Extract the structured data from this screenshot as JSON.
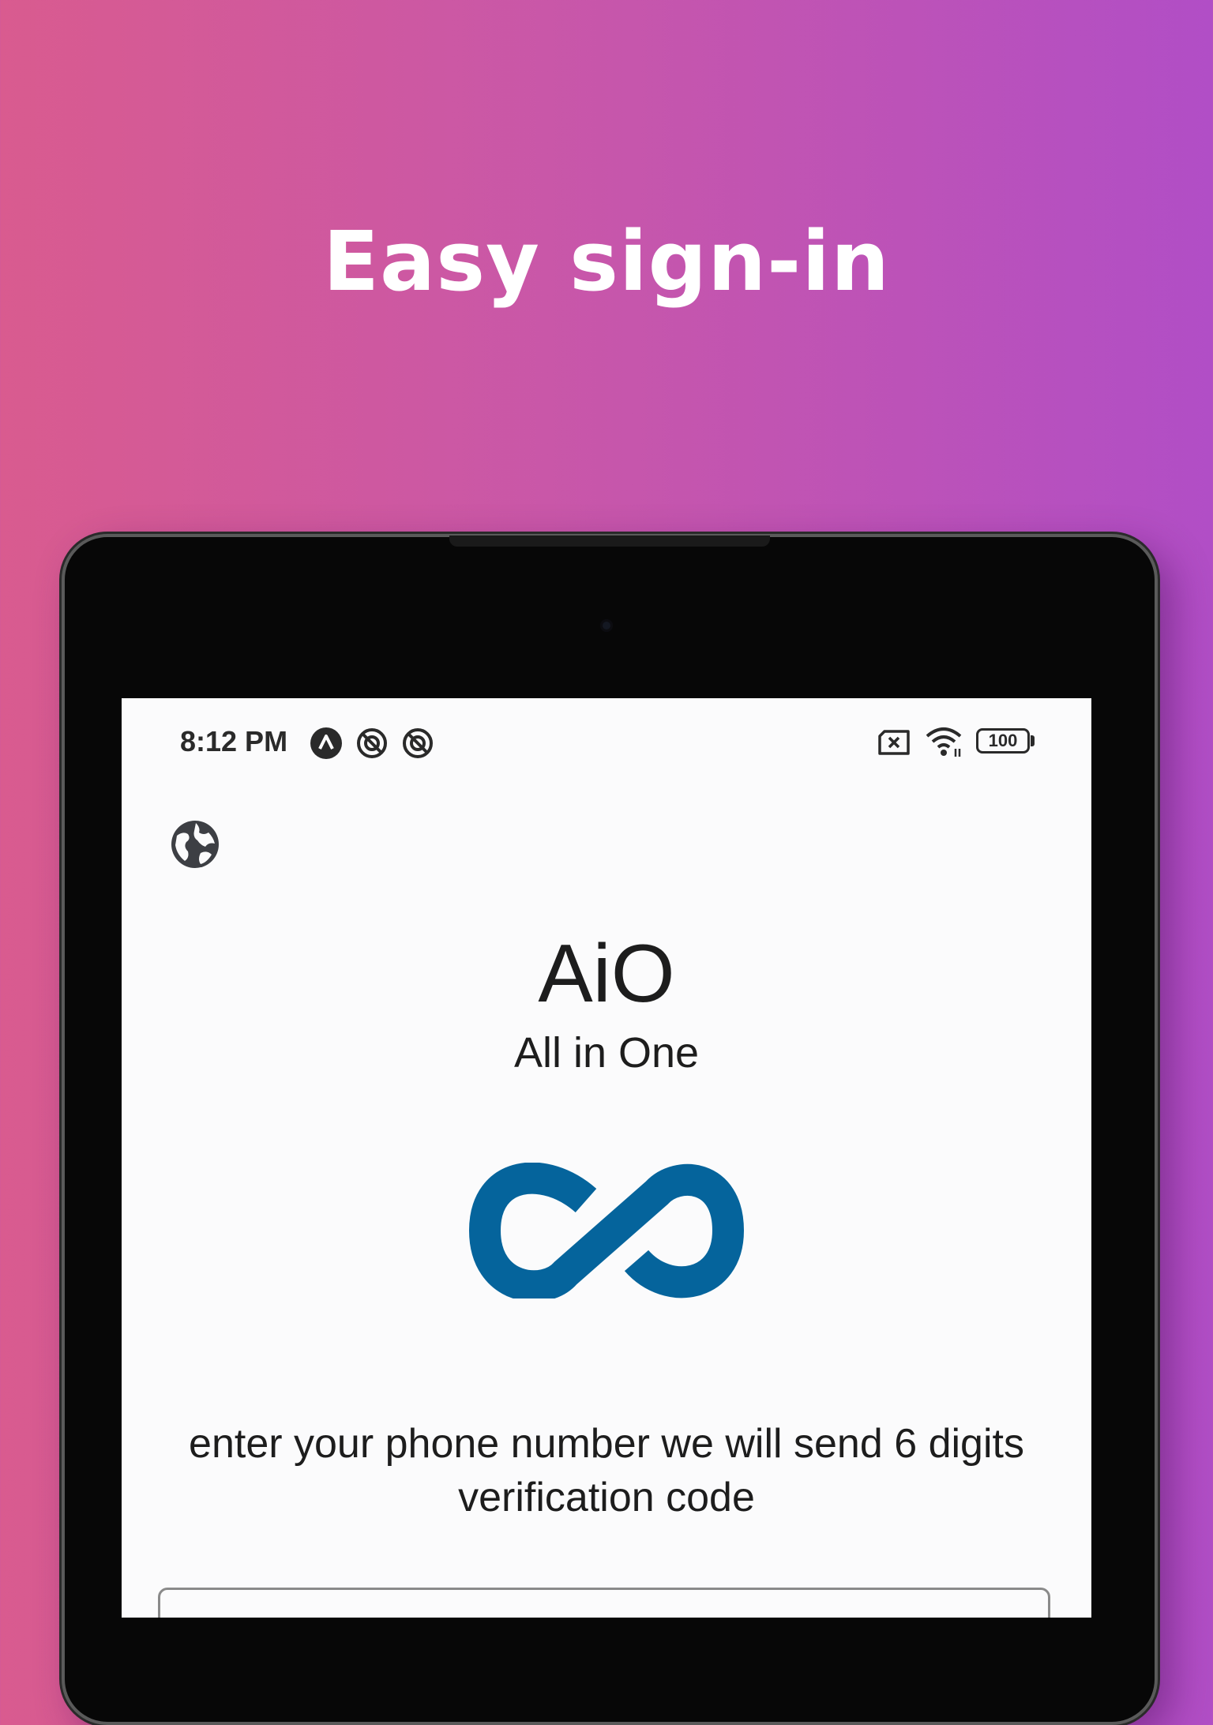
{
  "hero": {
    "title": "Easy sign-in"
  },
  "status_bar": {
    "time": "8:12 PM",
    "battery_level": "100",
    "left_icons": [
      "app-notification-icon",
      "no-tracking-icon",
      "no-tracking-icon"
    ],
    "right_icons": [
      "no-sim-icon",
      "wifi-icon",
      "battery-icon"
    ]
  },
  "app": {
    "name": "AiO",
    "subtitle": "All in One",
    "logo_icon": "infinity-logo-icon",
    "logo_color": "#05649c",
    "language_icon": "globe-icon"
  },
  "form": {
    "instructions": "enter your phone number we will send 6 digits verification code",
    "phone_value": "",
    "phone_placeholder": ""
  },
  "colors": {
    "gradient_start": "#d95b8f",
    "gradient_end": "#b14ec6",
    "text_dark": "#1d1d1d"
  }
}
